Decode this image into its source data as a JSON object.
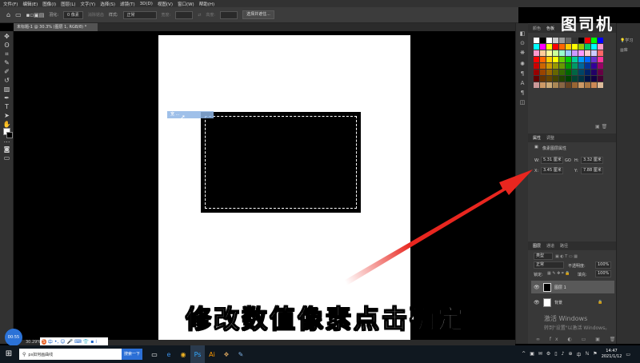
{
  "menu": [
    "文件(F)",
    "编辑(E)",
    "图像(I)",
    "图层(L)",
    "文字(Y)",
    "选择(S)",
    "滤镜(T)",
    "3D(D)",
    "视图(V)",
    "窗口(W)",
    "帮助(H)"
  ],
  "options": {
    "feather_label": "羽化:",
    "feather_value": "0 像素",
    "antialias": "消除锯齿",
    "style_label": "样式:",
    "style_value": "正常",
    "width_label": "宽度:",
    "height_label": "高度:",
    "select_mask_button": "选择并遮住..."
  },
  "document_tab": "未标题-1 @ 30.3% (图层 1, RGB/8) *",
  "selection_tooltip": "宽 ...",
  "panels": {
    "swatch_tabs": [
      "颜色",
      "色板"
    ],
    "learn_label": "学习",
    "library_label": "库",
    "properties_tabs": [
      "属性",
      "调整"
    ],
    "properties_title": "像素图层属性",
    "w_label": "W:",
    "w_value": "5.31 厘米",
    "h_label": "H:",
    "h_value": "3.32 厘米",
    "x_label": "X:",
    "x_value": "3.45 厘米",
    "y_label": "Y:",
    "y_value": "7.88 厘米",
    "link_label": "GO",
    "layers_tabs": [
      "图层",
      "通道",
      "路径"
    ],
    "layers_kind": "类型",
    "blend_mode": "正常",
    "opacity_label": "不透明度:",
    "opacity_value": "100%",
    "lock_label": "锁定:",
    "fill_label": "填充:",
    "fill_value": "100%",
    "layers": [
      {
        "name": "图层 1"
      },
      {
        "name": "背景"
      }
    ]
  },
  "swatch_colors": [
    "#ffffff",
    "#000000",
    "#ffffff",
    "#cccccc",
    "#999999",
    "#666666",
    "#333333",
    "#000000",
    "#ff0000",
    "#00ff00",
    "#0000ff",
    "#00ffff",
    "#ff00ff",
    "#ffff00",
    "#ff0000",
    "#ff6600",
    "#ffcc00",
    "#ffff00",
    "#99cc00",
    "#00cc66",
    "#00ffff",
    "#ff99cc",
    "#ff99cc",
    "#ffcc99",
    "#ffff99",
    "#ccff99",
    "#99ffcc",
    "#99ccff",
    "#cc99ff",
    "#ff99ff",
    "#ffcccc",
    "#ccccff",
    "#ff6666",
    "#ff0000",
    "#ff6600",
    "#ffcc00",
    "#ffff00",
    "#66cc00",
    "#00cc00",
    "#00cc99",
    "#0099ff",
    "#0066ff",
    "#6633cc",
    "#ff3399",
    "#cc0000",
    "#cc6600",
    "#cc9900",
    "#999900",
    "#669900",
    "#009900",
    "#009966",
    "#006699",
    "#003399",
    "#330099",
    "#990066",
    "#990000",
    "#994400",
    "#996600",
    "#666600",
    "#336600",
    "#006600",
    "#006644",
    "#004466",
    "#002266",
    "#220066",
    "#660044",
    "#660000",
    "#663300",
    "#664400",
    "#444400",
    "#224400",
    "#004400",
    "#004433",
    "#003344",
    "#001144",
    "#110044",
    "#440033",
    "#cc9999",
    "#cc9966",
    "#ccaa77",
    "#aa8855",
    "#886644",
    "#664422",
    "#996633",
    "#cc9966",
    "#aa7744",
    "#cc8855",
    "#ddbb99"
  ],
  "subtitle": "修改数值像素点击确定",
  "windows_activate": "激活 Windows",
  "windows_activate_sub": "转到\"设置\"以激活 Windows。",
  "watermark": "图司机",
  "status": {
    "zoom": "30.29%",
    "bubble": "00:55"
  },
  "ime": [
    "S",
    "中",
    "•,",
    "☺",
    "🎤",
    "⌨",
    "👕",
    "▪",
    "⁞"
  ],
  "taskbar": {
    "search_text": "ps如何画曲线",
    "search_button": "搜索一下",
    "time": "14:47",
    "date": "2021/1/12",
    "app_icons": [
      "▭",
      "e",
      "◉",
      "Ps",
      "Ai",
      "❖",
      "✎"
    ],
    "tray_icons": [
      "^",
      "▣",
      "✉",
      "⚙",
      "▯",
      "♪",
      "⊕",
      "中",
      "ℕ",
      "⚑"
    ]
  },
  "colors": {
    "accent_arrow": "#e8261f",
    "selection": "#8fb6e6"
  }
}
